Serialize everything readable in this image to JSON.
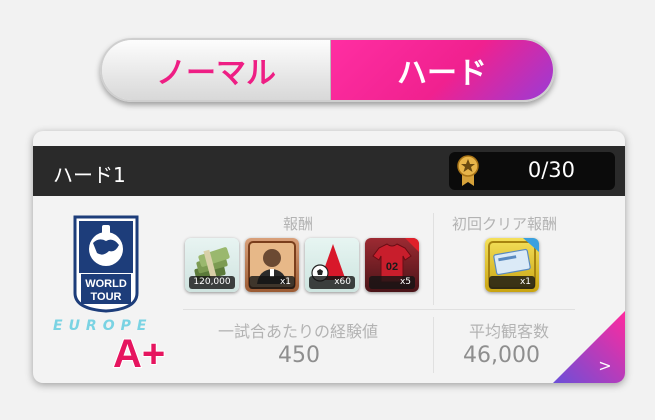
{
  "difficulty": {
    "normal_label": "ノーマル",
    "hard_label": "ハード",
    "selected": "ハード"
  },
  "stage": {
    "title": "ハード1",
    "progress": "0/30",
    "logo_lines": [
      "WORLD",
      "TOUR"
    ],
    "region": "EUROPE",
    "grade": "A+"
  },
  "rewards": {
    "label": "報酬",
    "items": [
      {
        "icon": "money-stack-icon",
        "qty": "120,000"
      },
      {
        "icon": "player-card-icon",
        "qty": "x1"
      },
      {
        "icon": "training-cones-icon",
        "qty": "x60"
      },
      {
        "icon": "jersey-02-icon",
        "qty": "x5"
      }
    ]
  },
  "first_clear": {
    "label": "初回クリア報酬",
    "items": [
      {
        "icon": "ticket-icon",
        "qty": "x1"
      }
    ]
  },
  "stats": {
    "exp_label": "一試合あたりの経験値",
    "exp_value": "450",
    "audience_label": "平均観客数",
    "audience_value": "46,000"
  },
  "next_arrow": ">",
  "colors": {
    "accent_pink": "#ee1e84",
    "accent_purple": "#9a3bd6",
    "header_dark": "#2a2a2a"
  }
}
